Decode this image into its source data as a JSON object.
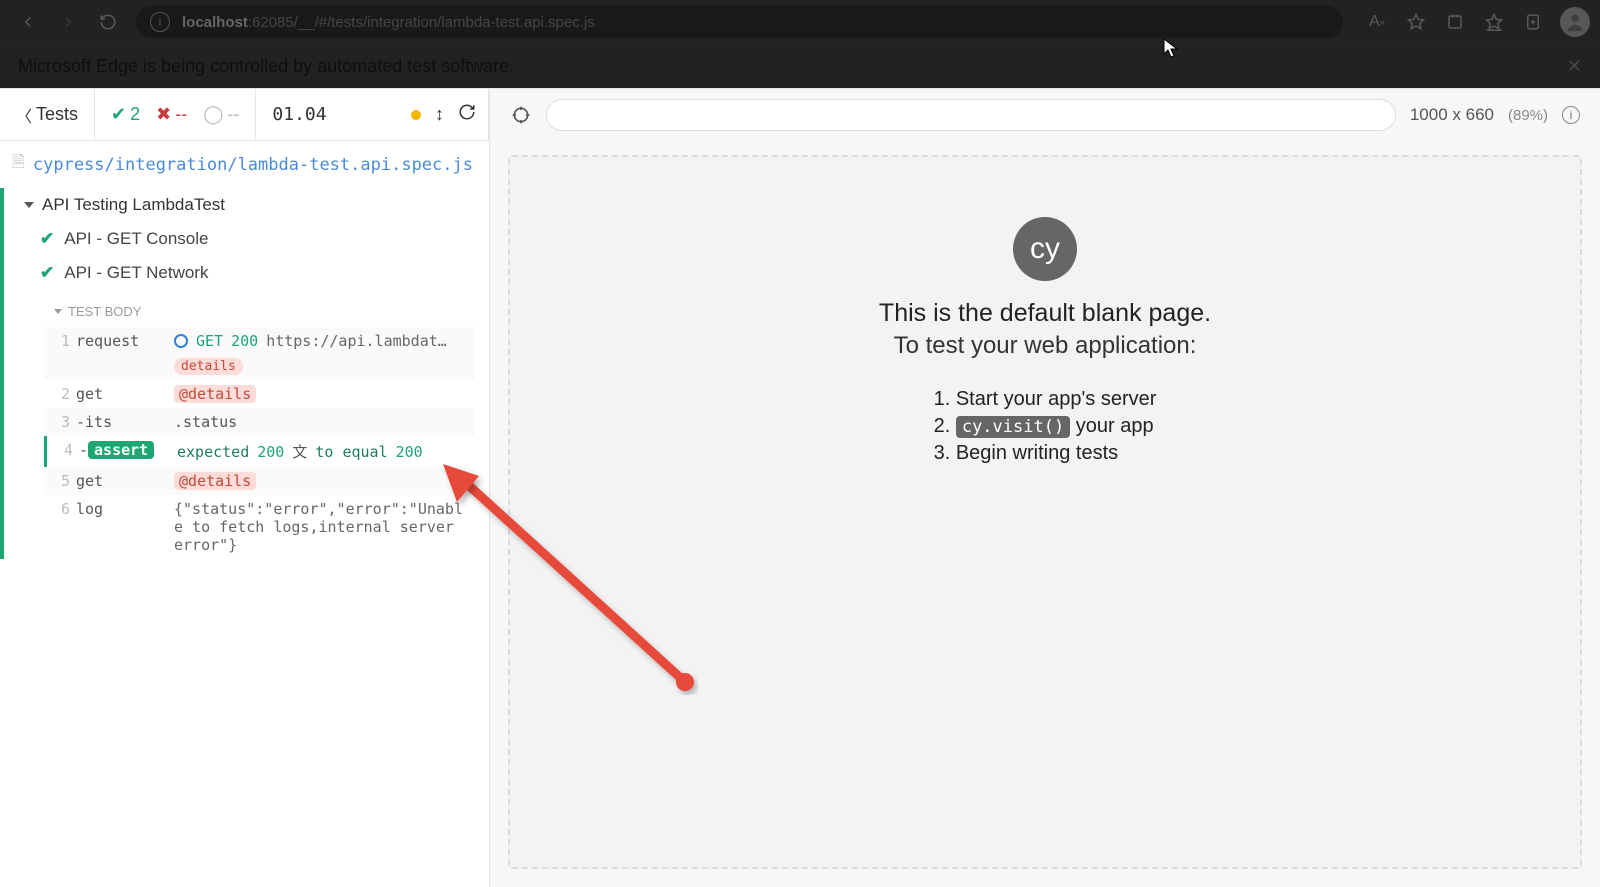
{
  "browser": {
    "url_host": "localhost",
    "url_rest": ":62085/__/#/tests/integration/lambda-test.api.spec.js",
    "banner": "Microsoft Edge is being controlled by automated test software."
  },
  "toolbar": {
    "tests_label": "Tests",
    "passed": "2",
    "failed": "--",
    "pending": "--",
    "time": "01.04",
    "viewport": "1000 x 660",
    "viewport_pct": "(89%)"
  },
  "spec": {
    "path": "cypress/integration/lambda-test.api.spec.js",
    "suite": "API Testing LambdaTest",
    "tests": [
      {
        "name": "API - GET Console"
      },
      {
        "name": "API - GET Network"
      }
    ]
  },
  "body": {
    "label": "TEST BODY",
    "rows": [
      {
        "n": "1",
        "cmd": "request",
        "method": "GET",
        "code": "200",
        "url": "https://api.lambdat…",
        "pill": "details"
      },
      {
        "n": "2",
        "cmd": "get",
        "alias": "@details"
      },
      {
        "n": "3",
        "cmd": "-its",
        "plain": ".status"
      },
      {
        "n": "4",
        "cmd": "-",
        "assert": "assert",
        "expected": "expected",
        "v1": "200",
        "mid": "to equal",
        "v2": "200"
      },
      {
        "n": "5",
        "cmd": "get",
        "alias": "@details"
      },
      {
        "n": "6",
        "cmd": "log",
        "plain": "{\"status\":\"error\",\"error\":\"Unable to fetch logs,internal server error\"}"
      }
    ]
  },
  "preview": {
    "logo": "cy",
    "line1": "This is the default blank page.",
    "line2": "To test your web application:",
    "steps": {
      "s1": "Start your app's server",
      "s2a": "cy.visit()",
      "s2b": " your app",
      "s3": "Begin writing tests"
    }
  }
}
